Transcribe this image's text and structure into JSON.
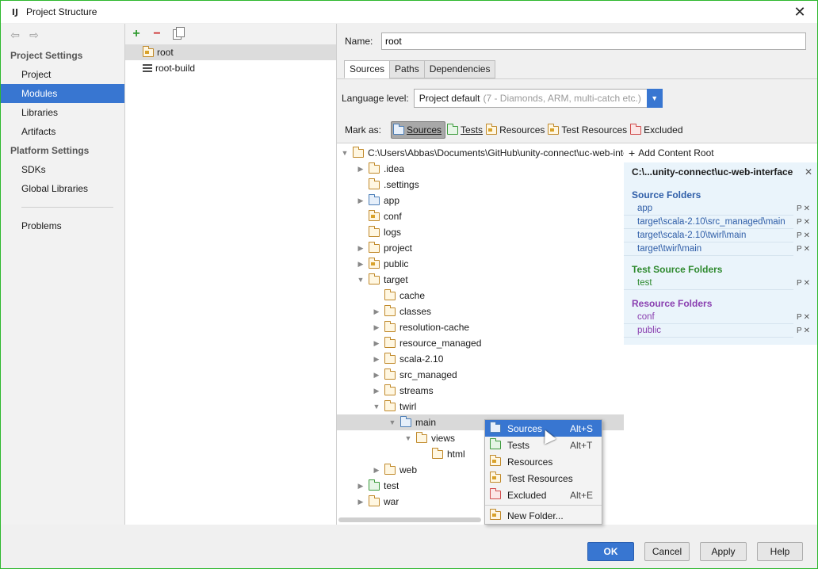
{
  "window": {
    "title": "Project Structure"
  },
  "nav": {
    "section1": "Project Settings",
    "items1": [
      "Project",
      "Modules",
      "Libraries",
      "Artifacts"
    ],
    "section2": "Platform Settings",
    "items2": [
      "SDKs",
      "Global Libraries"
    ],
    "problems": "Problems"
  },
  "modules": [
    "root",
    "root-build"
  ],
  "name_label": "Name:",
  "name_value": "root",
  "tabs": [
    "Sources",
    "Paths",
    "Dependencies"
  ],
  "language": {
    "label": "Language level:",
    "value": "Project default",
    "hint": "(7 - Diamonds, ARM, multi-catch etc.)"
  },
  "markas": {
    "label": "Mark as:",
    "buttons": [
      "Sources",
      "Tests",
      "Resources",
      "Test Resources",
      "Excluded"
    ]
  },
  "tree": [
    {
      "label": "C:\\Users\\Abbas\\Documents\\GitHub\\unity-connect\\uc-web-interface",
      "depth": 0,
      "expand": "open",
      "kind": "plain"
    },
    {
      "label": ".idea",
      "depth": 1,
      "expand": "closed",
      "kind": "plain"
    },
    {
      "label": ".settings",
      "depth": 1,
      "expand": "none",
      "kind": "plain"
    },
    {
      "label": "app",
      "depth": 1,
      "expand": "closed",
      "kind": "source"
    },
    {
      "label": "conf",
      "depth": 1,
      "expand": "none",
      "kind": "resource"
    },
    {
      "label": "logs",
      "depth": 1,
      "expand": "none",
      "kind": "plain"
    },
    {
      "label": "project",
      "depth": 1,
      "expand": "closed",
      "kind": "plain"
    },
    {
      "label": "public",
      "depth": 1,
      "expand": "closed",
      "kind": "resource"
    },
    {
      "label": "target",
      "depth": 1,
      "expand": "open",
      "kind": "plain"
    },
    {
      "label": "cache",
      "depth": 2,
      "expand": "none",
      "kind": "plain"
    },
    {
      "label": "classes",
      "depth": 2,
      "expand": "closed",
      "kind": "plain"
    },
    {
      "label": "resolution-cache",
      "depth": 2,
      "expand": "closed",
      "kind": "plain"
    },
    {
      "label": "resource_managed",
      "depth": 2,
      "expand": "closed",
      "kind": "plain"
    },
    {
      "label": "scala-2.10",
      "depth": 2,
      "expand": "closed",
      "kind": "plain"
    },
    {
      "label": "src_managed",
      "depth": 2,
      "expand": "closed",
      "kind": "plain"
    },
    {
      "label": "streams",
      "depth": 2,
      "expand": "closed",
      "kind": "plain"
    },
    {
      "label": "twirl",
      "depth": 2,
      "expand": "open",
      "kind": "plain"
    },
    {
      "label": "main",
      "depth": 3,
      "expand": "open",
      "kind": "source",
      "highlight": true
    },
    {
      "label": "views",
      "depth": 4,
      "expand": "open",
      "kind": "plain"
    },
    {
      "label": "html",
      "depth": 5,
      "expand": "none",
      "kind": "plain"
    },
    {
      "label": "web",
      "depth": 2,
      "expand": "closed",
      "kind": "plain"
    },
    {
      "label": "test",
      "depth": 1,
      "expand": "closed",
      "kind": "test"
    },
    {
      "label": "war",
      "depth": 1,
      "expand": "closed",
      "kind": "plain"
    }
  ],
  "content_root": {
    "add": "Add Content Root",
    "title": "C:\\...unity-connect\\uc-web-interface",
    "source_title": "Source Folders",
    "source": [
      "app",
      "target\\scala-2.10\\src_managed\\main",
      "target\\scala-2.10\\twirl\\main",
      "target\\twirl\\main"
    ],
    "test_title": "Test Source Folders",
    "test": [
      "test"
    ],
    "resource_title": "Resource Folders",
    "resource": [
      "conf",
      "public"
    ]
  },
  "context_menu": [
    {
      "label": "Sources",
      "shortcut": "Alt+S",
      "kind": "source",
      "active": true
    },
    {
      "label": "Tests",
      "shortcut": "Alt+T",
      "kind": "test"
    },
    {
      "label": "Resources",
      "shortcut": "",
      "kind": "resource"
    },
    {
      "label": "Test Resources",
      "shortcut": "",
      "kind": "testres"
    },
    {
      "label": "Excluded",
      "shortcut": "Alt+E",
      "kind": "excluded"
    },
    {
      "label": "New Folder...",
      "shortcut": "",
      "kind": "newfolder"
    }
  ],
  "buttons": {
    "ok": "OK",
    "cancel": "Cancel",
    "apply": "Apply",
    "help": "Help"
  }
}
